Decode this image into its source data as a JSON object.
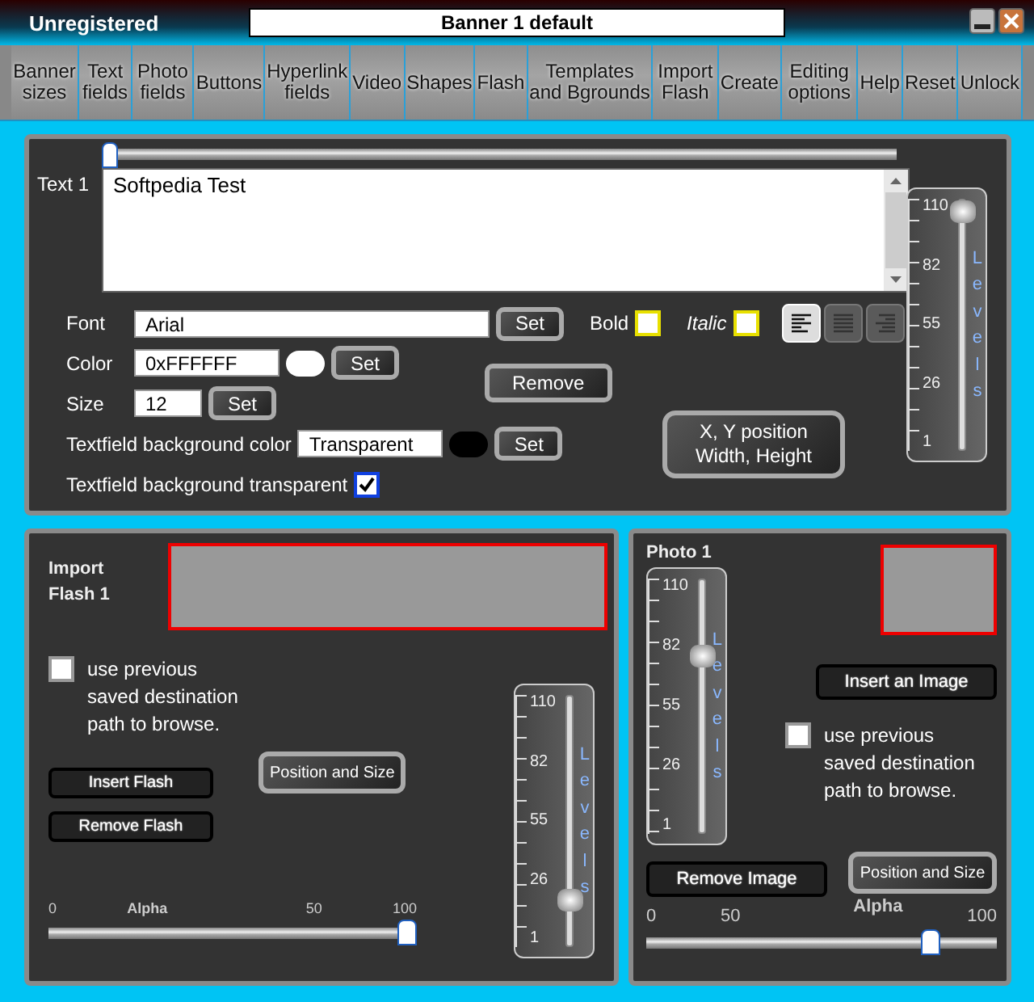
{
  "window": {
    "title": "Unregistered",
    "banner_name": "Banner 1 default"
  },
  "tabs": [
    "Banner sizes",
    "Text fields",
    "Photo fields",
    "Buttons",
    "Hyperlink fields",
    "Video",
    "Shapes",
    "Flash",
    "Templates and Bgrounds",
    "Import Flash",
    "Create",
    "Editing options",
    "Help",
    "Reset",
    "Unlock"
  ],
  "text_panel": {
    "position_slider": {
      "level": 0
    },
    "label": "Text 1",
    "text": "Softpedia Test",
    "font": {
      "label": "Font",
      "value": "Arial",
      "button": "Set"
    },
    "bold": {
      "label": "Bold",
      "checked": false
    },
    "italic": {
      "label": "Italic",
      "checked": false
    },
    "alignments": [
      {
        "kind": "left",
        "selected": true
      },
      {
        "kind": "justify",
        "selected": false
      },
      {
        "kind": "right",
        "selected": false
      }
    ],
    "color": {
      "label": "Color",
      "value": "0xFFFFFF",
      "color": "#ffffff",
      "button": "Set"
    },
    "size": {
      "label": "Size",
      "value": "12",
      "button": "Set"
    },
    "remove_button": "Remove",
    "position_button": [
      "X, Y position",
      "Width, Height"
    ],
    "bg_color": {
      "label": "Textfield background color",
      "value": "Transparent",
      "color": "#000000",
      "button": "Set"
    },
    "bg_transparent": {
      "label": "Textfield background transparent",
      "checked": true
    },
    "levels": {
      "label": "Levels",
      "ticks": [
        "110",
        "82",
        "55",
        "26",
        "1"
      ],
      "level": 1
    }
  },
  "flash_panel": {
    "title": "Import Flash 1",
    "use_previous": {
      "label": "use previous saved destination path to browse.",
      "checked": false
    },
    "insert_button": "Insert Flash",
    "remove_button": "Remove Flash",
    "position_button": "Position and Size",
    "levels": {
      "label": "Levels",
      "ticks": [
        "110",
        "82",
        "55",
        "26",
        "1"
      ],
      "level": 0.15
    },
    "alpha": {
      "label": "Alpha",
      "ticks": [
        "0",
        "50",
        "100"
      ],
      "level": 1
    }
  },
  "photo_panel": {
    "title": "Photo 1",
    "levels": {
      "label": "Levels",
      "ticks": [
        "110",
        "82",
        "55",
        "26",
        "1"
      ],
      "level": 0.72
    },
    "insert_button": "Insert an Image",
    "use_previous": {
      "label": "use previous saved destination path to browse.",
      "checked": false
    },
    "remove_button": "Remove Image",
    "position_button": "Position and Size",
    "alpha": {
      "label": "Alpha",
      "ticks": [
        "0",
        "50",
        "100"
      ],
      "level": 0.83
    }
  }
}
